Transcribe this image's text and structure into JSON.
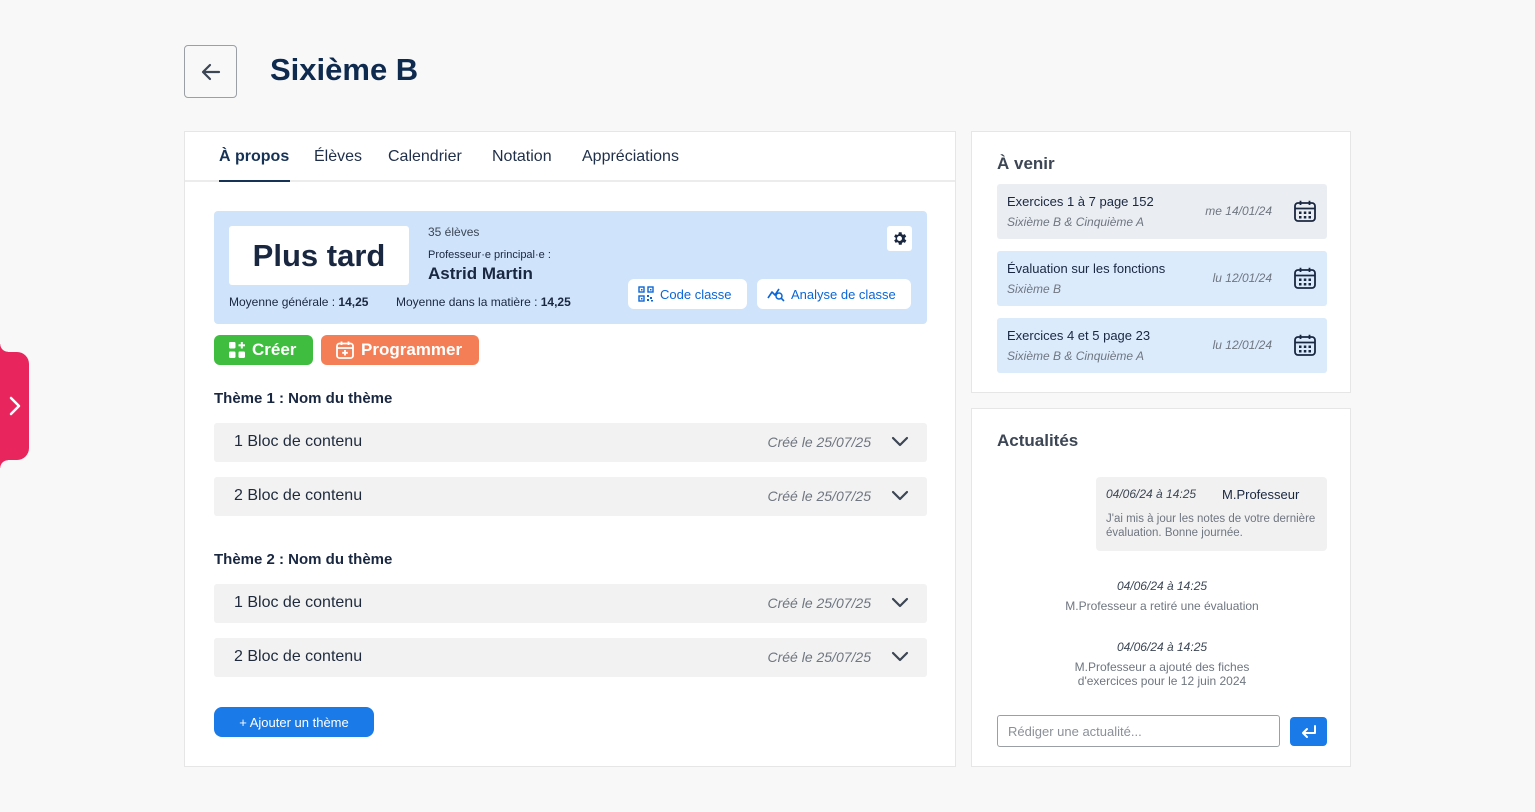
{
  "page": {
    "title": "Sixième B"
  },
  "tabs": [
    "À propos",
    "Élèves",
    "Calendrier",
    "Notation",
    "Appréciations"
  ],
  "class_info": {
    "grade": "Plus tard",
    "students": "35 élèves",
    "prof_label": "Professeur·e principal·e :",
    "prof_name": "Astrid Martin",
    "avg_general_label": "Moyenne générale : ",
    "avg_general_value": "14,25",
    "avg_subject_label": "Moyenne dans la matière : ",
    "avg_subject_value": "14,25",
    "code_label": "Code classe",
    "analysis_label": "Analyse de classe"
  },
  "actions": {
    "create": "Créer",
    "program": "Programmer"
  },
  "themes": [
    {
      "title": "Thème 1 : Nom du thème",
      "blocks": [
        {
          "label": "1 Bloc de contenu",
          "date": "Créé le 25/07/25"
        },
        {
          "label": "2 Bloc de contenu",
          "date": "Créé le 25/07/25"
        }
      ]
    },
    {
      "title": "Thème 2 : Nom du thème",
      "blocks": [
        {
          "label": "1 Bloc de contenu",
          "date": "Créé le 25/07/25"
        },
        {
          "label": "2 Bloc de contenu",
          "date": "Créé le 25/07/25"
        }
      ]
    }
  ],
  "add_theme": "+ Ajouter un thème",
  "upcoming": {
    "title": "À venir",
    "items": [
      {
        "title": "Exercices 1 à 7 page 152",
        "sub": "Sixième B & Cinquième A",
        "date": "me 14/01/24"
      },
      {
        "title": "Évaluation sur les fonctions",
        "sub": "Sixième B",
        "date": "lu 12/01/24"
      },
      {
        "title": "Exercices 4 et 5 page 23",
        "sub": "Sixième B & Cinquième A",
        "date": "lu 12/01/24"
      }
    ]
  },
  "news": {
    "title": "Actualités",
    "message": {
      "time": "04/06/24 à 14:25",
      "author": "M.Professeur",
      "text": "J'ai mis à jour les notes de votre dernière évaluation. Bonne journée."
    },
    "logs": [
      {
        "time": "04/06/24 à 14:25",
        "text": "M.Professeur a retiré une évaluation"
      },
      {
        "time": "04/06/24 à 14:25",
        "text": "M.Professeur a ajouté des fiches d'exercices pour le 12 juin 2024"
      }
    ],
    "input_placeholder": "Rédiger une actualité..."
  },
  "colors": {
    "accent": "#1a7ae8",
    "side_tab": "#e8255d",
    "create": "#3fbd3f",
    "program": "#f47f56",
    "class_panel": "#cfe3fb"
  },
  "icons": [
    "chevron-right-icon",
    "arrow-left-icon",
    "gear-icon",
    "qr-code-icon",
    "analysis-icon",
    "add-grid-icon",
    "calendar-plus-icon",
    "chevron-down-icon",
    "calendar-icon",
    "enter-icon"
  ]
}
